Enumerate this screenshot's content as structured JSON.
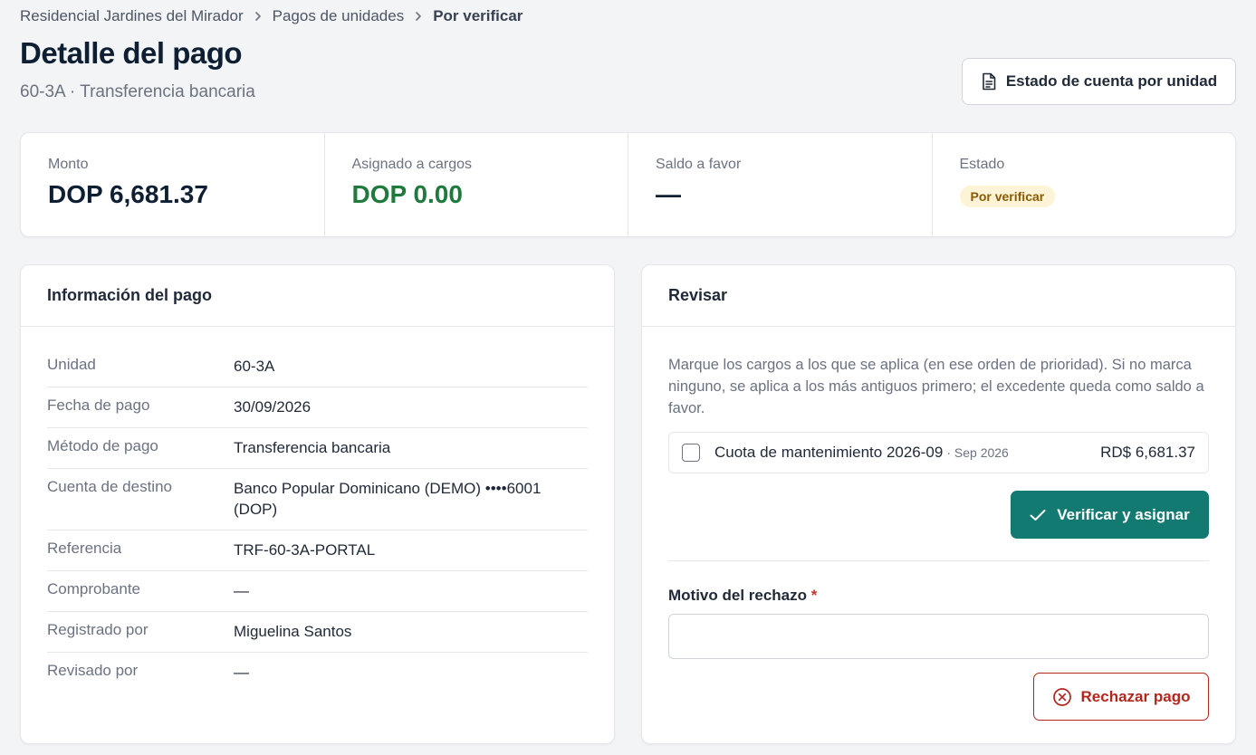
{
  "breadcrumb": {
    "items": [
      "Residencial Jardines del Mirador",
      "Pagos de unidades"
    ],
    "current": "Por verificar"
  },
  "header": {
    "title": "Detalle del pago",
    "subtitle": "60-3A · Transferencia bancaria",
    "statement_button": "Estado de cuenta por unidad"
  },
  "summary": {
    "amount_label": "Monto",
    "amount_value": "DOP 6,681.37",
    "assigned_label": "Asignado a cargos",
    "assigned_value": "DOP 0.00",
    "balance_label": "Saldo a favor",
    "balance_value": "—",
    "status_label": "Estado",
    "status_value": "Por verificar"
  },
  "info": {
    "title": "Información del pago",
    "rows": [
      {
        "label": "Unidad",
        "value": "60-3A"
      },
      {
        "label": "Fecha de pago",
        "value": "30/09/2026"
      },
      {
        "label": "Método de pago",
        "value": "Transferencia bancaria"
      },
      {
        "label": "Cuenta de destino",
        "value": "Banco Popular Dominicano (DEMO) ••••6001 (DOP)"
      },
      {
        "label": "Referencia",
        "value": "TRF-60-3A-PORTAL"
      },
      {
        "label": "Comprobante",
        "value": "—"
      },
      {
        "label": "Registrado por",
        "value": "Miguelina Santos"
      },
      {
        "label": "Revisado por",
        "value": "—"
      }
    ]
  },
  "review": {
    "title": "Revisar",
    "help": "Marque los cargos a los que se aplica (en ese orden de prioridad). Si no marca ninguno, se aplica a los más antiguos primero; el excedente queda como saldo a favor.",
    "charge": {
      "name": "Cuota de mantenimiento 2026-09",
      "period": "· Sep 2026",
      "amount": "RD$ 6,681.37",
      "checked": false
    },
    "verify_button": "Verificar y asignar",
    "reject_label": "Motivo del rechazo",
    "required_mark": "*",
    "reject_input_value": "",
    "reject_button": "Rechazar pago"
  },
  "icons": {
    "breadcrumb_separator": "chevron-right-icon",
    "statement_button": "document-icon",
    "verify_button": "check-icon",
    "reject_button": "x-circle-icon"
  },
  "colors": {
    "primary": "#137a72",
    "danger": "#b3261e",
    "assigned_value": "#1f7a3e",
    "status_badge_bg": "#fdf3d6",
    "status_badge_text": "#8a5a00"
  }
}
